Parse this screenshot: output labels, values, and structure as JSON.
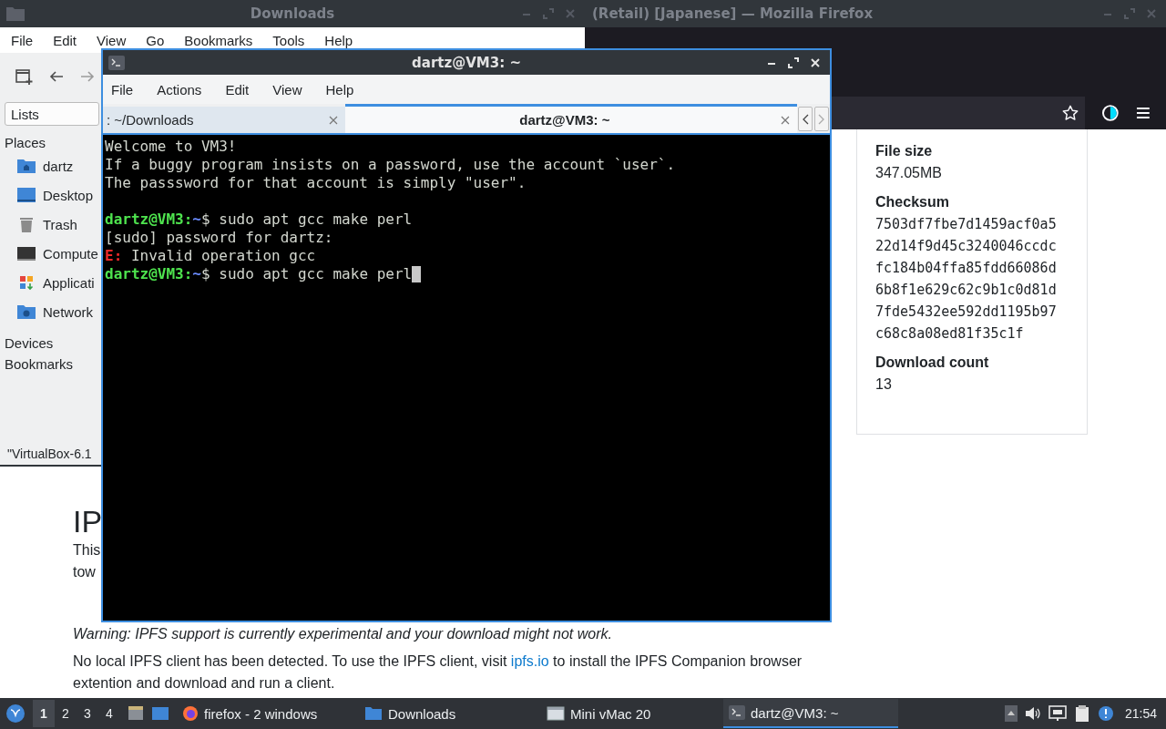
{
  "firefox_window": {
    "title": "(Retail) [Japanese] — Mozilla Firefox",
    "page": {
      "heading": "IP",
      "paragraph_lines": [
        "This",
        "tow"
      ],
      "warning": "Warning: IPFS support is currently experimental and your download might not work.",
      "notice_before": "No local IPFS client has been detected. To use the IPFS client, visit",
      "notice_link": "ipfs.io",
      "notice_after": "to install the IPFS Companion browser extention and download and run a client."
    },
    "details": [
      {
        "kind": "text",
        "label": "File size",
        "lines": [
          "347.05MB"
        ]
      },
      {
        "kind": "hash",
        "label": "Checksum",
        "lines": [
          "7503df7fbe7d1459acf0a5",
          "22d14f9d45c3240046ccdc",
          "fc184b04ffa85fdd66086d",
          "6b8f1e629c62c9b1c0d81d",
          "7fde5432ee592dd1195b97",
          "c68c8a08ed81f35c1f"
        ]
      },
      {
        "kind": "text",
        "label": "Download count",
        "lines": [
          "13"
        ]
      }
    ]
  },
  "downloads_window": {
    "title": "Downloads",
    "menu": [
      "File",
      "Edit",
      "View",
      "Go",
      "Bookmarks",
      "Tools",
      "Help"
    ],
    "list_selector": "Lists",
    "sections": [
      {
        "label": "Places",
        "items": [
          "dartz",
          "Desktop",
          "Trash",
          "Compute",
          "Applicati",
          "Network"
        ]
      },
      {
        "label": "Devices"
      },
      {
        "label": "Bookmarks"
      }
    ],
    "status_bar": "\"VirtualBox-6.1"
  },
  "terminal_window": {
    "title": "dartz@VM3: ~",
    "menu": [
      "File",
      "Actions",
      "Edit",
      "View",
      "Help"
    ],
    "tabs": [
      {
        "label": ": ~/Downloads",
        "selected": false
      },
      {
        "label": "dartz@VM3: ~",
        "selected": true
      }
    ],
    "lines": [
      {
        "kind": "text",
        "text": "Welcome to VM3!"
      },
      {
        "kind": "text",
        "text": "If a buggy program insists on a password, use the account `user`."
      },
      {
        "kind": "text",
        "text": "The passsword for that account is simply \"user\"."
      },
      {
        "kind": "blank"
      },
      {
        "kind": "prompt",
        "user": "dartz@VM3",
        "colon": ":",
        "path": "~",
        "command": "$ sudo apt gcc make perl",
        "cursor": false
      },
      {
        "kind": "text",
        "text": "[sudo] password for dartz:"
      },
      {
        "kind": "error",
        "prefix": "E:",
        "text": " Invalid operation gcc"
      },
      {
        "kind": "prompt",
        "user": "dartz@VM3",
        "colon": ":",
        "path": "~",
        "command": "$ sudo apt gcc make perl",
        "cursor": true
      }
    ]
  },
  "taskbar": {
    "workspaces": [
      {
        "label": "1",
        "selected": true
      },
      {
        "label": "2",
        "selected": false
      },
      {
        "label": "3",
        "selected": false
      },
      {
        "label": "4",
        "selected": false
      }
    ],
    "tasks": [
      {
        "label": "firefox - 2 windows",
        "selected": false
      },
      {
        "label": "Downloads",
        "selected": false
      },
      {
        "label": "Mini vMac 20",
        "selected": false
      },
      {
        "label": "dartz@VM3: ~",
        "selected": true
      }
    ],
    "clock": "21:54"
  }
}
